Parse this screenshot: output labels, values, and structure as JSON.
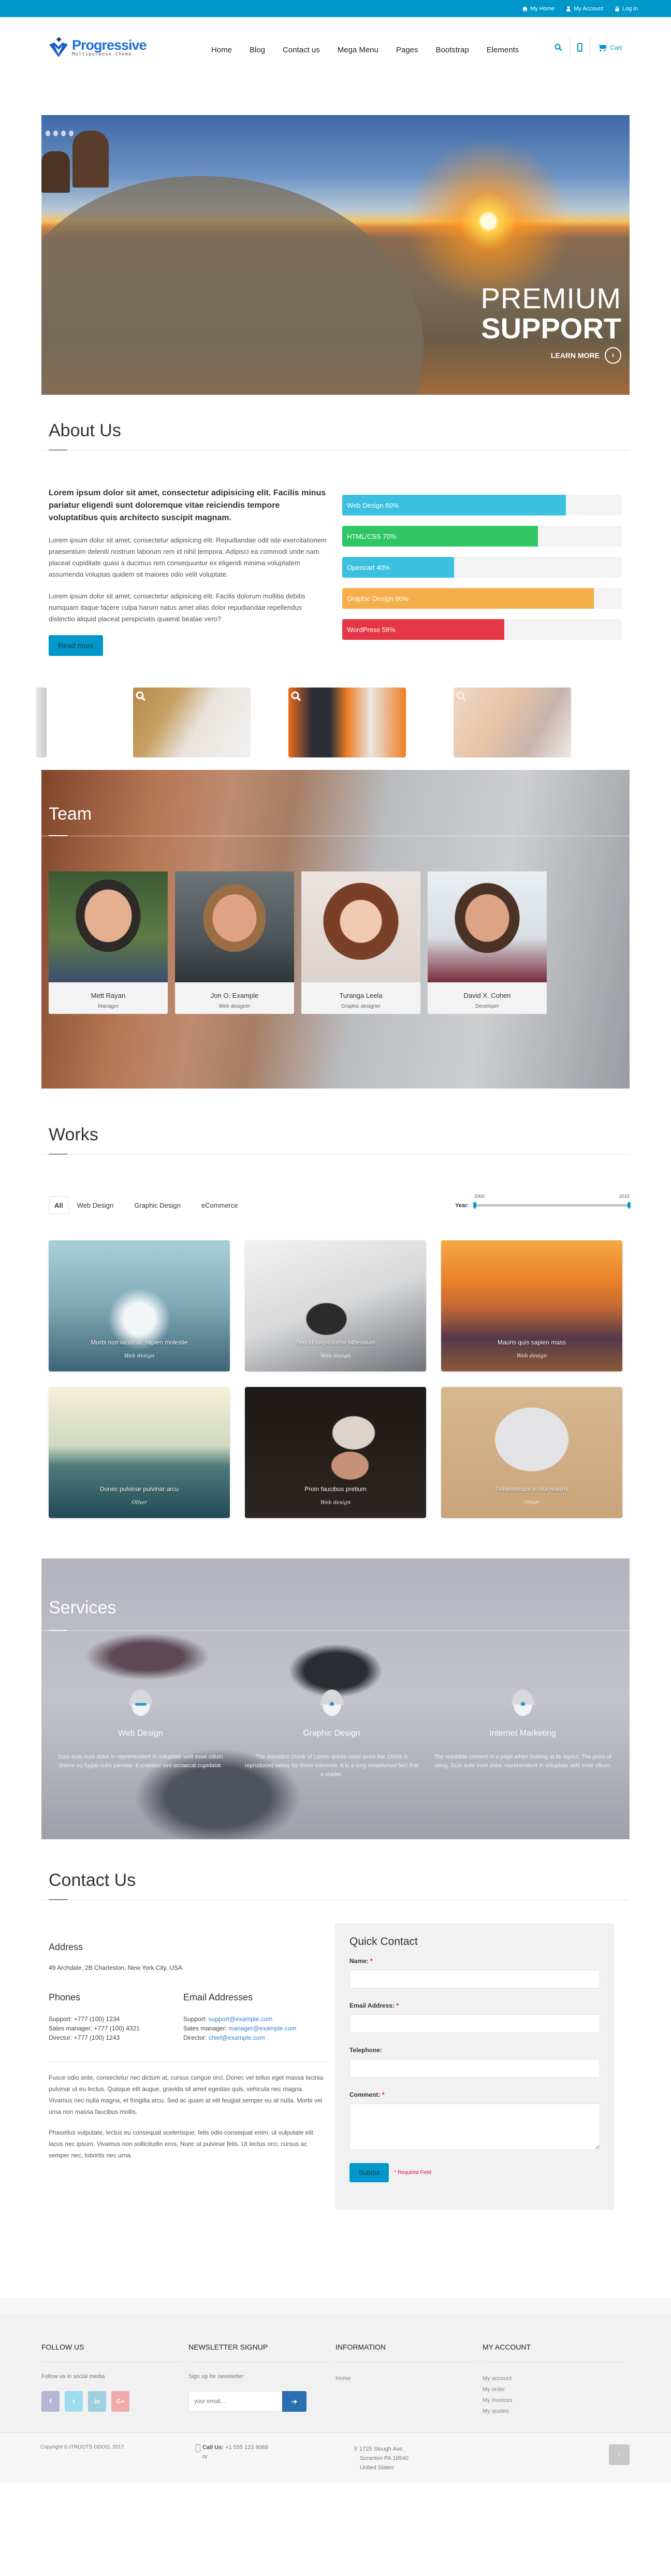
{
  "topbar": {
    "links": [
      {
        "icon": "home-icon",
        "label": "My Home"
      },
      {
        "icon": "user-icon",
        "label": "My Account"
      },
      {
        "icon": "lock-icon",
        "label": "Log in"
      }
    ]
  },
  "header": {
    "logo_title": "Progressive",
    "logo_subtitle": "Multipurpose theme",
    "nav": [
      "Home",
      "Blog",
      "Contact us",
      "Mega Menu",
      "Pages",
      "Bootstrap",
      "Elements"
    ],
    "cart_label": "Cart"
  },
  "slider": {
    "dot_count": 4,
    "caption_line1": "PREMIUM",
    "caption_line2": "SUPPORT",
    "cta": "LEARN MORE"
  },
  "about": {
    "title": "About Us",
    "lead": "Lorem ipsum dolor sit amet, consectetur adipisicing elit. Facilis minus pariatur eligendi sunt doloremque vitae reiciendis tempore voluptatibus quis architecto suscipit magnam.",
    "para1": "Lorem ipsum dolor sit amet, consectetur adipisicing elit. Repudiandae odit iste exercitationem praesentium deleniti nostrum laborum rem id nihil tempora. Adipisci ea commodi unde nam placeat cupiditate quasi a ducimus rem consequuntur ex eligendi minima voluptatem assumenda voluptas quidem sit maiores odio velit voluptate.",
    "para2": "Lorem ipsum dolor sit amet, consectetur adipisicing elit. Facilis dolorum mollitia debitis numquam itaque facere culpa harum natus amet alias dolor repudiandae repellendus distinctio aliquid placeat perspiciatis quaerat beatae vero?",
    "button": "Read more",
    "skills": [
      {
        "label": "Web Design 80%",
        "percent": 80,
        "color": "#3cc0e0"
      },
      {
        "label": "HTML/CSS 70%",
        "percent": 70,
        "color": "#30c664"
      },
      {
        "label": "Opencart 40%",
        "percent": 40,
        "color": "#3cc0e0"
      },
      {
        "label": "Graphic Design 90%",
        "percent": 90,
        "color": "#f6ae4a"
      },
      {
        "label": "WordPress 58%",
        "percent": 58,
        "color": "#e53646"
      }
    ]
  },
  "team": {
    "title": "Team",
    "members": [
      {
        "name": "Mett Rayan",
        "role": "Manager"
      },
      {
        "name": "Jon O. Example",
        "role": "Web designer"
      },
      {
        "name": "Turanga Leela",
        "role": "Graphic designer"
      },
      {
        "name": "David X. Cohen",
        "role": "Developer"
      }
    ]
  },
  "works": {
    "title": "Works",
    "filters": [
      "All",
      "Web Design",
      "Graphic Design",
      "eCommerce"
    ],
    "active_filter": "All",
    "year_label": "Year:",
    "year_min": "2000",
    "year_max": "2015",
    "items": [
      {
        "title": "Morbi non lacus ac sapien molestie",
        "category": "Web design"
      },
      {
        "title": "Sed at turpis tortor bibendum",
        "category": "Web design"
      },
      {
        "title": "Mauris quis sapien mass",
        "category": "Web design"
      },
      {
        "title": "Donec pulvinar pulvinar arcu",
        "category": "Other"
      },
      {
        "title": "Proin faucibus pretium",
        "category": "Web design"
      },
      {
        "title": "Pellentesque in dui mauris",
        "category": "Other"
      }
    ]
  },
  "services": {
    "title": "Services",
    "items": [
      {
        "title": "Web Design",
        "text": "Duis aute irure dolor in reprehenderit in voluptate velit esse cillum dolore eu fugiat nulla pariatur. Excepteur sint occaecat cupidatat."
      },
      {
        "title": "Graphic Design",
        "text": "The standard chunk of Lorem Ipsum used since the 1500s is reproduced below for those intereste. It is a long established fact that a reader."
      },
      {
        "title": "Internet Marketing",
        "text": "The readable content of a page when looking at its layout. The point of using. Duis aute irure dolor reprehenderit in voluptate velit esse cillum."
      }
    ]
  },
  "contact": {
    "title": "Contact Us",
    "address_heading": "Address",
    "address": "49 Archdale, 2B Charleston, New York City, USA",
    "phones_heading": "Phones",
    "phones": [
      "Support: +777 (100) 1234",
      "Sales manager: +777 (100) 4321",
      "Director: +777 (100) 1243"
    ],
    "emails_heading": "Email Addresses",
    "emails": [
      {
        "label": "Support: ",
        "email": "support@example.com"
      },
      {
        "label": "Sales manager: ",
        "email": "manager@example.com"
      },
      {
        "label": "Director: ",
        "email": "chief@example.com"
      }
    ],
    "para1": "Fusce odio ante, consectetur nec dictum at, cursus congue orci. Donec vel tellus eget massa lacinia pulvinar ut eu lectus. Quisque elit augue, gravida sit amet egestas quis, vehicula nec magna. Vivamus nec nulla magna, et fringilla arcu. Sed ac quam at elit feugiat semper eu at nulla. Morbi vel urna non massa faucibus mollis.",
    "para2": "Phasellus vulputate, lectus eu consequat scelerisque, felis odio consequat enim, ut vulputate elit lacus nec ipsum. Vivamus non sollicitudin eros. Nunc ut pulvinar felis. Ut lectus orci, cursus ac semper nec, lobortis nec urna.",
    "form": {
      "title": "Quick Contact",
      "name_label": "Name:",
      "email_label": "Email Address:",
      "phone_label": "Telephone:",
      "comment_label": "Comment:",
      "required_mark": "*",
      "submit": "Submit",
      "required_note": "* Required Field"
    }
  },
  "footer": {
    "follow_heading": "FOLLOW US",
    "follow_text": "Follow us in social media",
    "socials": [
      {
        "name": "facebook",
        "glyph": "f",
        "color": "#b3b7d3"
      },
      {
        "name": "twitter",
        "glyph": "t",
        "color": "#9ddcef"
      },
      {
        "name": "linkedin",
        "glyph": "in",
        "color": "#9fd0e0"
      },
      {
        "name": "google-plus",
        "glyph": "G+",
        "color": "#efaaaa"
      }
    ],
    "newsletter_heading": "NEWSLETTER SIGNUP",
    "newsletter_text": "Sign up for newsletter",
    "newsletter_placeholder": "your email...",
    "info_heading": "INFORMATION",
    "info_links": [
      "Home"
    ],
    "account_heading": "MY ACCOUNT",
    "account_links": [
      "My account",
      "My order",
      "My invoices",
      "My quotes"
    ],
    "copyright": "Copyright © ITROOTS ODOO, 2017",
    "call_label": "Call Us:",
    "call_number": "+1 555 123 8069",
    "call_or": "or",
    "address_lines": [
      "1725 Slough Ave.",
      "Scranton PA 18540",
      "United States"
    ]
  }
}
